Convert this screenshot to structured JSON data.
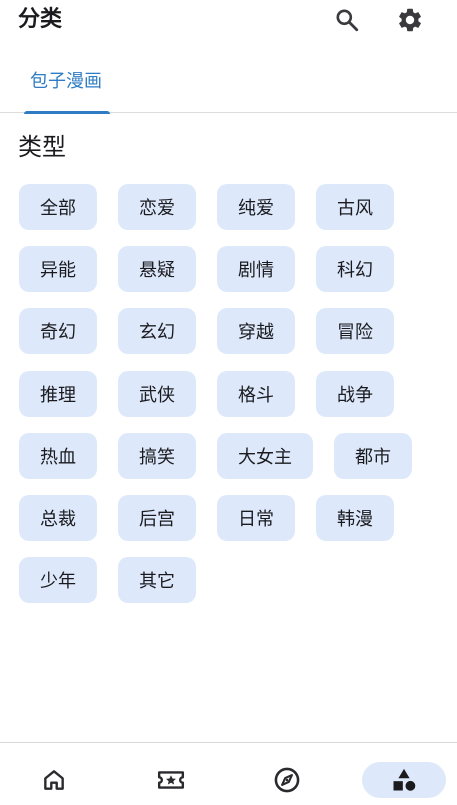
{
  "header": {
    "title": "分类",
    "search_icon": "search-icon",
    "settings_icon": "gear-icon"
  },
  "tabs": [
    {
      "label": "包子漫画",
      "selected": true
    }
  ],
  "section": {
    "title": "类型"
  },
  "categories": [
    "全部",
    "恋爱",
    "纯爱",
    "古风",
    "异能",
    "悬疑",
    "剧情",
    "科幻",
    "奇幻",
    "玄幻",
    "穿越",
    "冒险",
    "推理",
    "武侠",
    "格斗",
    "战争",
    "热血",
    "搞笑",
    "大女主",
    "都市",
    "总裁",
    "后宫",
    "日常",
    "韩漫",
    "少年",
    "其它"
  ],
  "bottom_nav": [
    {
      "icon": "home-icon",
      "selected": false
    },
    {
      "icon": "ticket-star-icon",
      "selected": false
    },
    {
      "icon": "compass-icon",
      "selected": false
    },
    {
      "icon": "shapes-icon",
      "selected": true
    }
  ],
  "colors": {
    "accent": "#2f7cc4",
    "chip_background": "#dde9fb",
    "text": "#1b1b1f"
  }
}
